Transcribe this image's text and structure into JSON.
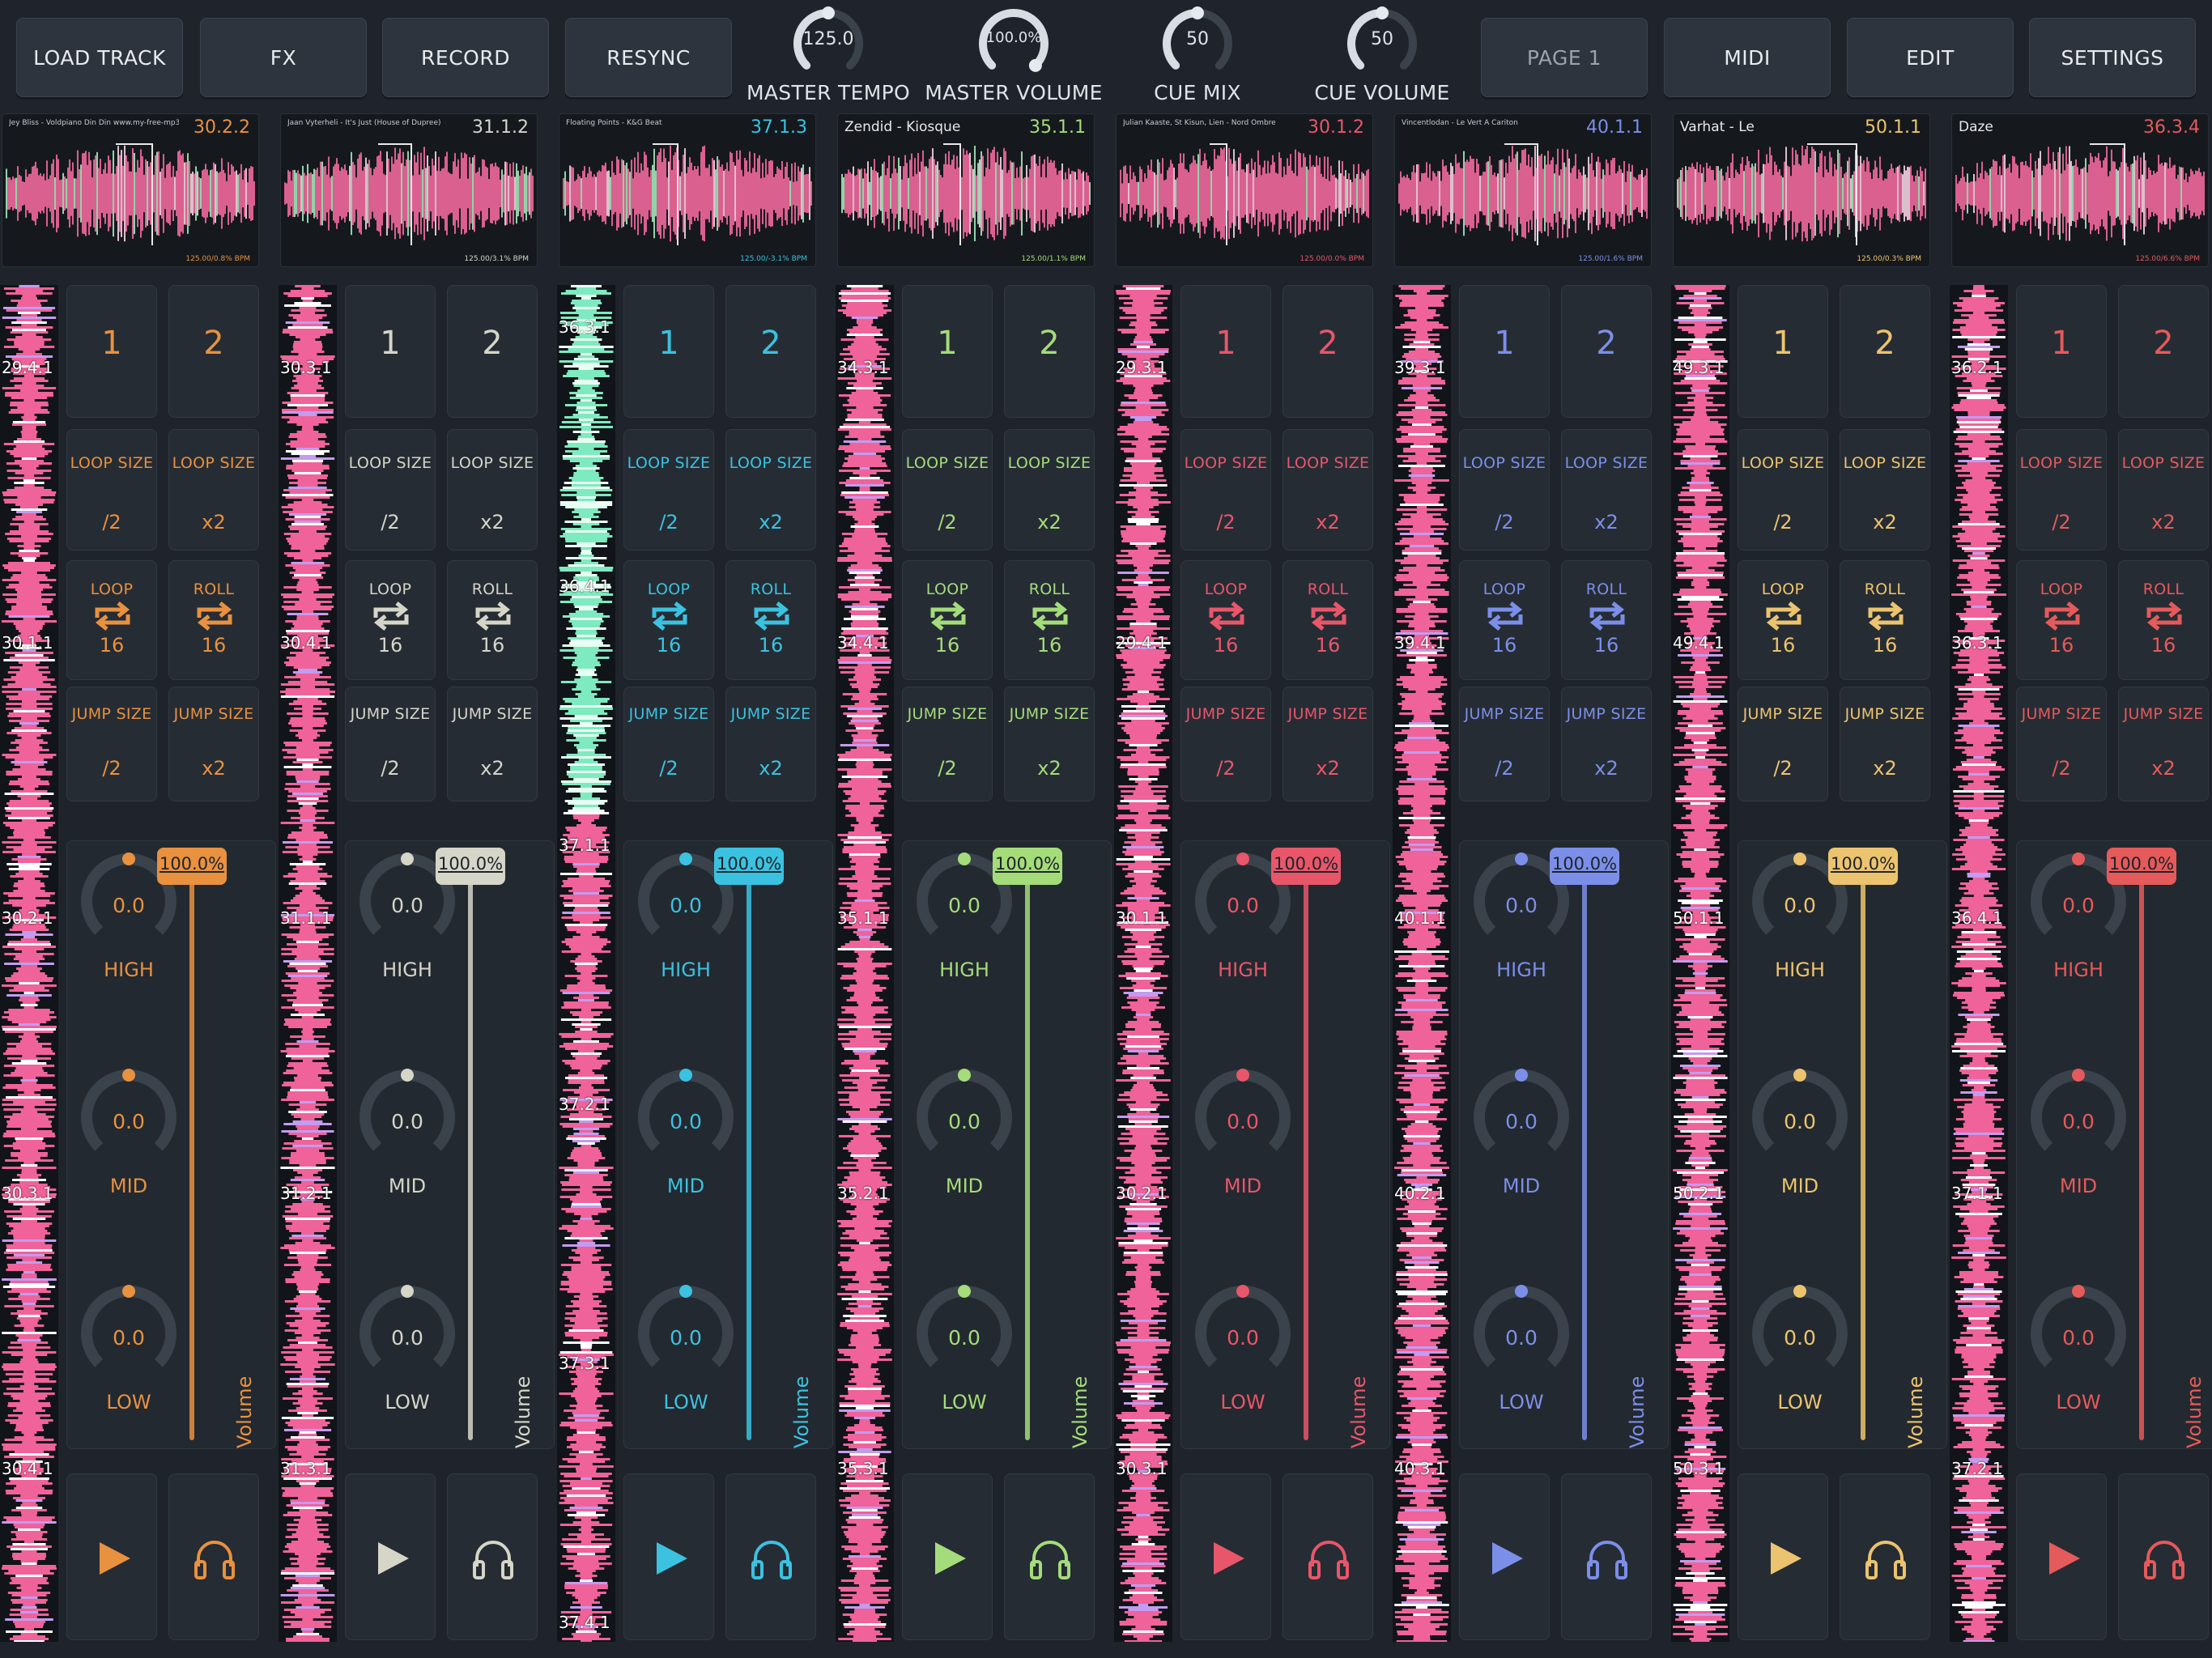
{
  "toolbar": {
    "buttons": [
      {
        "label": "LOAD TRACK"
      },
      {
        "label": "FX"
      },
      {
        "label": "RECORD"
      },
      {
        "label": "RESYNC"
      },
      {
        "label": "PAGE 1"
      },
      {
        "label": "MIDI"
      },
      {
        "label": "EDIT"
      },
      {
        "label": "SETTINGS"
      }
    ],
    "knobs": [
      {
        "value": "125.0",
        "label": "MASTER TEMPO",
        "level": 0.5
      },
      {
        "value": "100.0%",
        "label": "MASTER VOLUME",
        "level": 1.0
      },
      {
        "value": "50",
        "label": "CUE MIX",
        "level": 0.5
      },
      {
        "value": "50",
        "label": "CUE VOLUME",
        "level": 0.5
      }
    ]
  },
  "labels": {
    "loop_size": "LOOP SIZE",
    "jump_size": "JUMP SIZE",
    "half": "/2",
    "double": "x2",
    "loop": "LOOP",
    "roll": "ROLL",
    "sixteen": "16",
    "pad1": "1",
    "pad2": "2",
    "high": "HIGH",
    "mid": "MID",
    "low": "LOW",
    "volume": "Volume"
  },
  "decks": [
    {
      "accent": "#e8913f",
      "title": "Jey Bliss - Voldpiano Din Din www.my-free-mp3.net",
      "position": "30.2.2",
      "bpm": "125.00/0.8% BPM",
      "volume": "100.0%",
      "eq": [
        "0.0",
        "0.0",
        "0.0"
      ],
      "beats": [
        "29.4.1",
        "30.1.1",
        "30.2.1",
        "30.3.1",
        "30.4.1"
      ]
    },
    {
      "accent": "#d5d5c8",
      "title": "Jaan Vyterheli - It's Just (House of Dupree)",
      "position": "31.1.2",
      "bpm": "125.00/3.1% BPM",
      "volume": "100.0%",
      "eq": [
        "0.0",
        "0.0",
        "0.0"
      ],
      "beats": [
        "30.3.1",
        "30.4.1",
        "31.1.1",
        "31.2.1",
        "31.3.1"
      ]
    },
    {
      "accent": "#3bc2e0",
      "title": "Floating Points - K&G Beat",
      "position": "37.1.3",
      "bpm": "125.00/-3.1% BPM",
      "volume": "100.0%",
      "eq": [
        "0.0",
        "0.0",
        "0.0"
      ],
      "beats": [
        "36.3.1",
        "36.4.1",
        "37.1.1",
        "37.2.1",
        "37.3.1",
        "37.4.1"
      ]
    },
    {
      "accent": "#a4dc7a",
      "title": "Zendid - Kiosque",
      "position": "35.1.1",
      "bpm": "125.00/1.1% BPM",
      "volume": "100.0%",
      "eq": [
        "0.0",
        "0.0",
        "0.0"
      ],
      "beats": [
        "34.3.1",
        "34.4.1",
        "35.1.1",
        "35.2.1",
        "35.3.1"
      ]
    },
    {
      "accent": "#e8566a",
      "title": "Julian Kaaste, St Kisun, Lien - Nord Ombre",
      "position": "30.1.2",
      "bpm": "125.00/0.0% BPM",
      "volume": "100.0%",
      "eq": [
        "0.0",
        "0.0",
        "0.0"
      ],
      "beats": [
        "29.3.1",
        "29.4.1",
        "30.1.1",
        "30.2.1",
        "30.3.1"
      ]
    },
    {
      "accent": "#7b8fe8",
      "title": "Vincentlodan - Le Vert A Cariton",
      "position": "40.1.1",
      "bpm": "125.00/1.6% BPM",
      "volume": "100.0%",
      "eq": [
        "0.0",
        "0.0",
        "0.0"
      ],
      "beats": [
        "39.3.1",
        "39.4.1",
        "40.1.1",
        "40.2.1",
        "40.3.1"
      ]
    },
    {
      "accent": "#ecc36e",
      "title": "Varhat - Le",
      "position": "50.1.1",
      "bpm": "125.00/0.3% BPM",
      "volume": "100.0%",
      "eq": [
        "0.0",
        "0.0",
        "0.0"
      ],
      "beats": [
        "49.3.1",
        "49.4.1",
        "50.1.1",
        "50.2.1",
        "50.3.1"
      ]
    },
    {
      "accent": "#e55a5a",
      "title": "Daze",
      "position": "36.3.4",
      "bpm": "125.00/6.6% BPM",
      "volume": "100.0%",
      "eq": [
        "0.0",
        "0.0",
        "0.0"
      ],
      "beats": [
        "36.2.1",
        "36.3.1",
        "36.4.1",
        "37.1.1",
        "37.2.1"
      ]
    }
  ]
}
